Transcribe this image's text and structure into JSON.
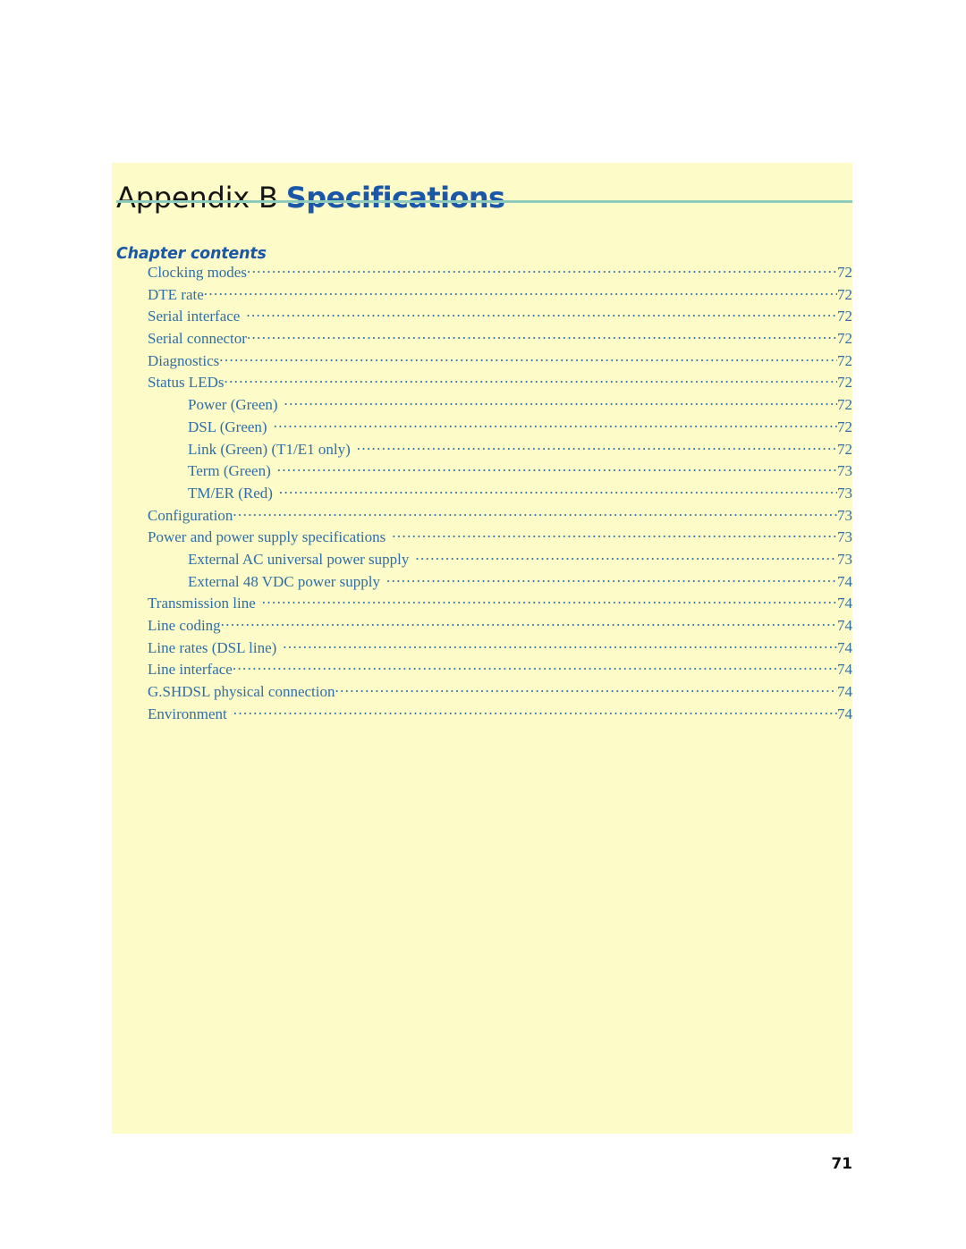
{
  "page": {
    "background_color": "#ffffff",
    "panel_color": "#fdfbc8",
    "rule_color": "#8ecbba",
    "title_accent_color": "#1b57a8",
    "toc_text_color": "#2f6ea6",
    "page_number": "71"
  },
  "header": {
    "appendix_label": "Appendix B",
    "appendix_name": "Specifications"
  },
  "chapter_contents": {
    "heading": "Chapter contents",
    "entries": [
      {
        "label": "Clocking modes",
        "page": "72",
        "level": 1,
        "gap": false
      },
      {
        "label": "DTE rate",
        "page": "72",
        "level": 1,
        "gap": false
      },
      {
        "label": "Serial interface",
        "page": "72",
        "level": 1,
        "gap": true
      },
      {
        "label": "Serial connector",
        "page": "72",
        "level": 1,
        "gap": false
      },
      {
        "label": "Diagnostics",
        "page": "72",
        "level": 1,
        "gap": false
      },
      {
        "label": "Status LEDs",
        "page": "72",
        "level": 1,
        "gap": false
      },
      {
        "label": "Power (Green)",
        "page": "72",
        "level": 2,
        "gap": true
      },
      {
        "label": "DSL (Green)",
        "page": "72",
        "level": 2,
        "gap": true
      },
      {
        "label": "Link (Green) (T1/E1 only)",
        "page": "72",
        "level": 2,
        "gap": true
      },
      {
        "label": "Term (Green)",
        "page": "73",
        "level": 2,
        "gap": true
      },
      {
        "label": "TM/ER (Red)",
        "page": "73",
        "level": 2,
        "gap": true
      },
      {
        "label": "Configuration",
        "page": "73",
        "level": 1,
        "gap": false
      },
      {
        "label": "Power and power supply specifications",
        "page": "73",
        "level": 1,
        "gap": true
      },
      {
        "label": "External AC universal power supply",
        "page": "73",
        "level": 2,
        "gap": true
      },
      {
        "label": "External 48 VDC power supply",
        "page": "74",
        "level": 2,
        "gap": true
      },
      {
        "label": "Transmission line",
        "page": "74",
        "level": 1,
        "gap": true
      },
      {
        "label": "Line coding",
        "page": "74",
        "level": 1,
        "gap": false
      },
      {
        "label": "Line rates (DSL line)",
        "page": "74",
        "level": 1,
        "gap": true
      },
      {
        "label": "Line interface",
        "page": "74",
        "level": 1,
        "gap": false
      },
      {
        "label": "G.SHDSL physical connection",
        "page": "74",
        "level": 1,
        "gap": false
      },
      {
        "label": "Environment",
        "page": "74",
        "level": 1,
        "gap": true
      }
    ]
  }
}
